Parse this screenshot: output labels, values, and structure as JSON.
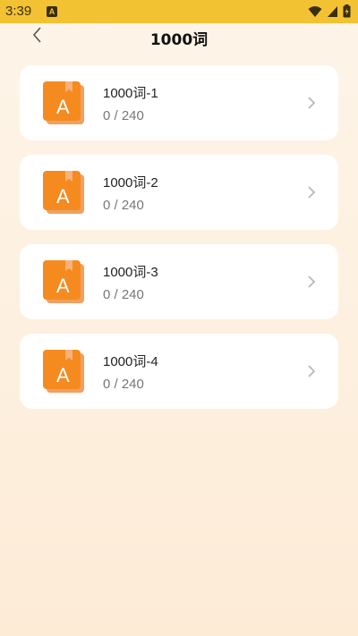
{
  "status": {
    "time": "3:39",
    "app_icon_letter": "A"
  },
  "header": {
    "title": "1000词"
  },
  "lists": [
    {
      "title": "1000词-1",
      "progress": "0 / 240",
      "icon_letter": "A"
    },
    {
      "title": "1000词-2",
      "progress": "0 / 240",
      "icon_letter": "A"
    },
    {
      "title": "1000词-3",
      "progress": "0 / 240",
      "icon_letter": "A"
    },
    {
      "title": "1000词-4",
      "progress": "0 / 240",
      "icon_letter": "A"
    }
  ],
  "colors": {
    "statusbar": "#f3c232",
    "book_icon": "#f58a1f",
    "book_icon_dark": "#f0a060"
  },
  "icons": {
    "back": "chevron-left-icon",
    "item": "book-icon",
    "arrow": "chevron-right-icon"
  }
}
